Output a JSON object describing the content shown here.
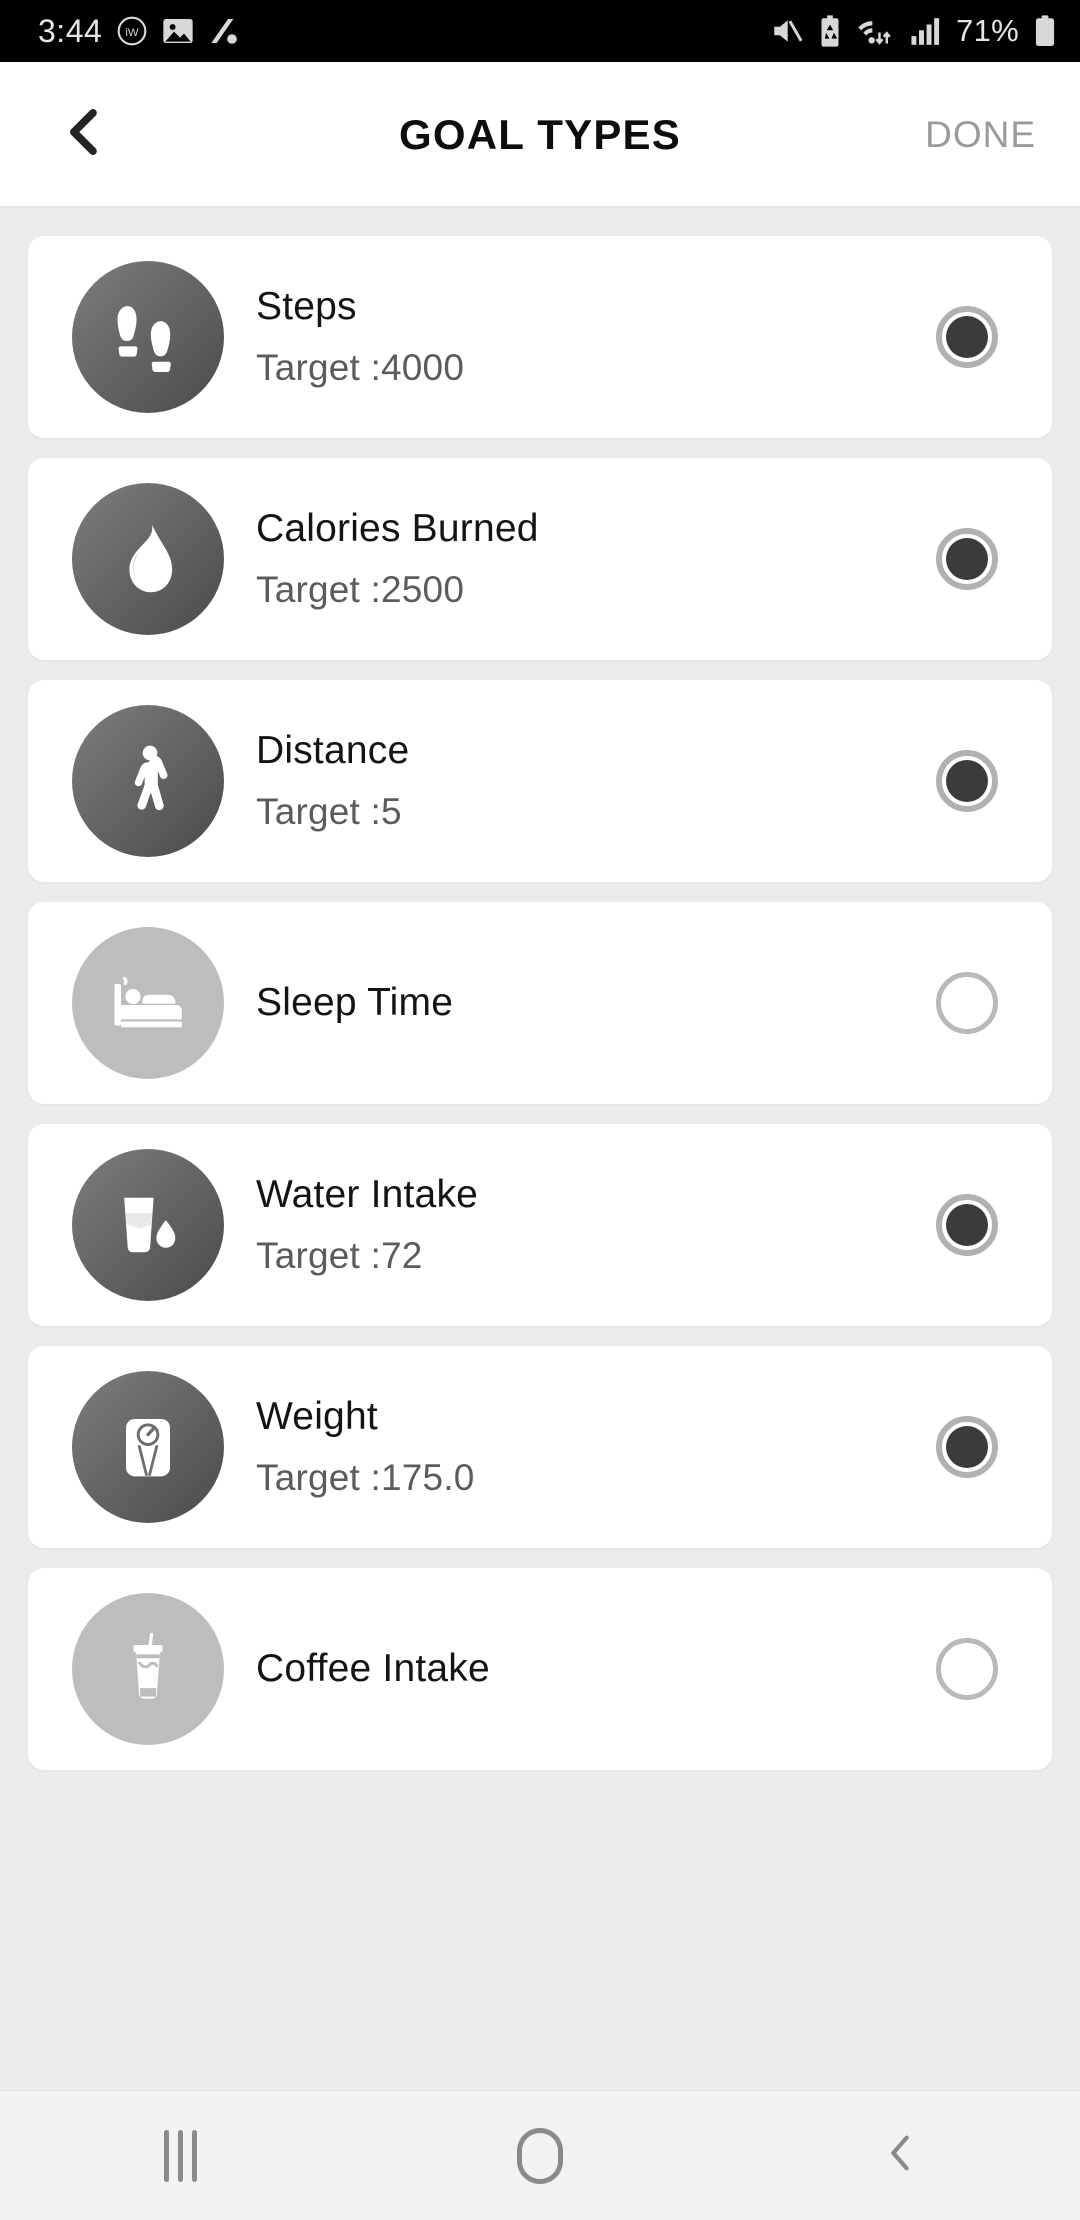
{
  "status_bar": {
    "time": "3:44",
    "battery_percent": "71%",
    "left_icons": [
      "iw-badge-icon",
      "image-icon",
      "percent-icon"
    ],
    "right_icons": [
      "mute-icon",
      "battery-saver-icon",
      "wifi-icon",
      "signal-icon",
      "battery-icon"
    ]
  },
  "header": {
    "back_icon": "chevron-left-icon",
    "title": "GOAL TYPES",
    "done_label": "DONE"
  },
  "colors": {
    "page_background": "#ebebeb",
    "card_background": "#ffffff",
    "title_text": "#141414",
    "subtitle_text": "#5c5c5c",
    "done_text": "#9a9a9a",
    "radio_ring": "#b1b1b1",
    "radio_dot": "#3b3b3b",
    "icon_circle_active": "#5a5a5a",
    "icon_circle_inactive": "#bdbdbd",
    "status_bar_background": "#000000",
    "nav_bar_background": "#f2f2f2"
  },
  "goal_types": [
    {
      "id": "steps",
      "icon": "footprints-icon",
      "title": "Steps",
      "target": "Target :4000",
      "selected": true,
      "has_target": true
    },
    {
      "id": "calories",
      "icon": "flame-icon",
      "title": "Calories Burned",
      "target": "Target :2500",
      "selected": true,
      "has_target": true
    },
    {
      "id": "distance",
      "icon": "walking-icon",
      "title": "Distance",
      "target": "Target :5",
      "selected": true,
      "has_target": true
    },
    {
      "id": "sleep",
      "icon": "bed-icon",
      "title": "Sleep Time",
      "target": "",
      "selected": false,
      "has_target": false
    },
    {
      "id": "water",
      "icon": "water-glass-icon",
      "title": "Water Intake",
      "target": "Target :72",
      "selected": true,
      "has_target": true
    },
    {
      "id": "weight",
      "icon": "scale-icon",
      "title": "Weight",
      "target": "Target :175.0",
      "selected": true,
      "has_target": true
    },
    {
      "id": "coffee",
      "icon": "coffee-cup-icon",
      "title": "Coffee Intake",
      "target": "",
      "selected": false,
      "has_target": false
    }
  ],
  "nav_bar": {
    "recents_label": "recents-icon",
    "home_label": "home-icon",
    "back_label": "back-icon"
  }
}
